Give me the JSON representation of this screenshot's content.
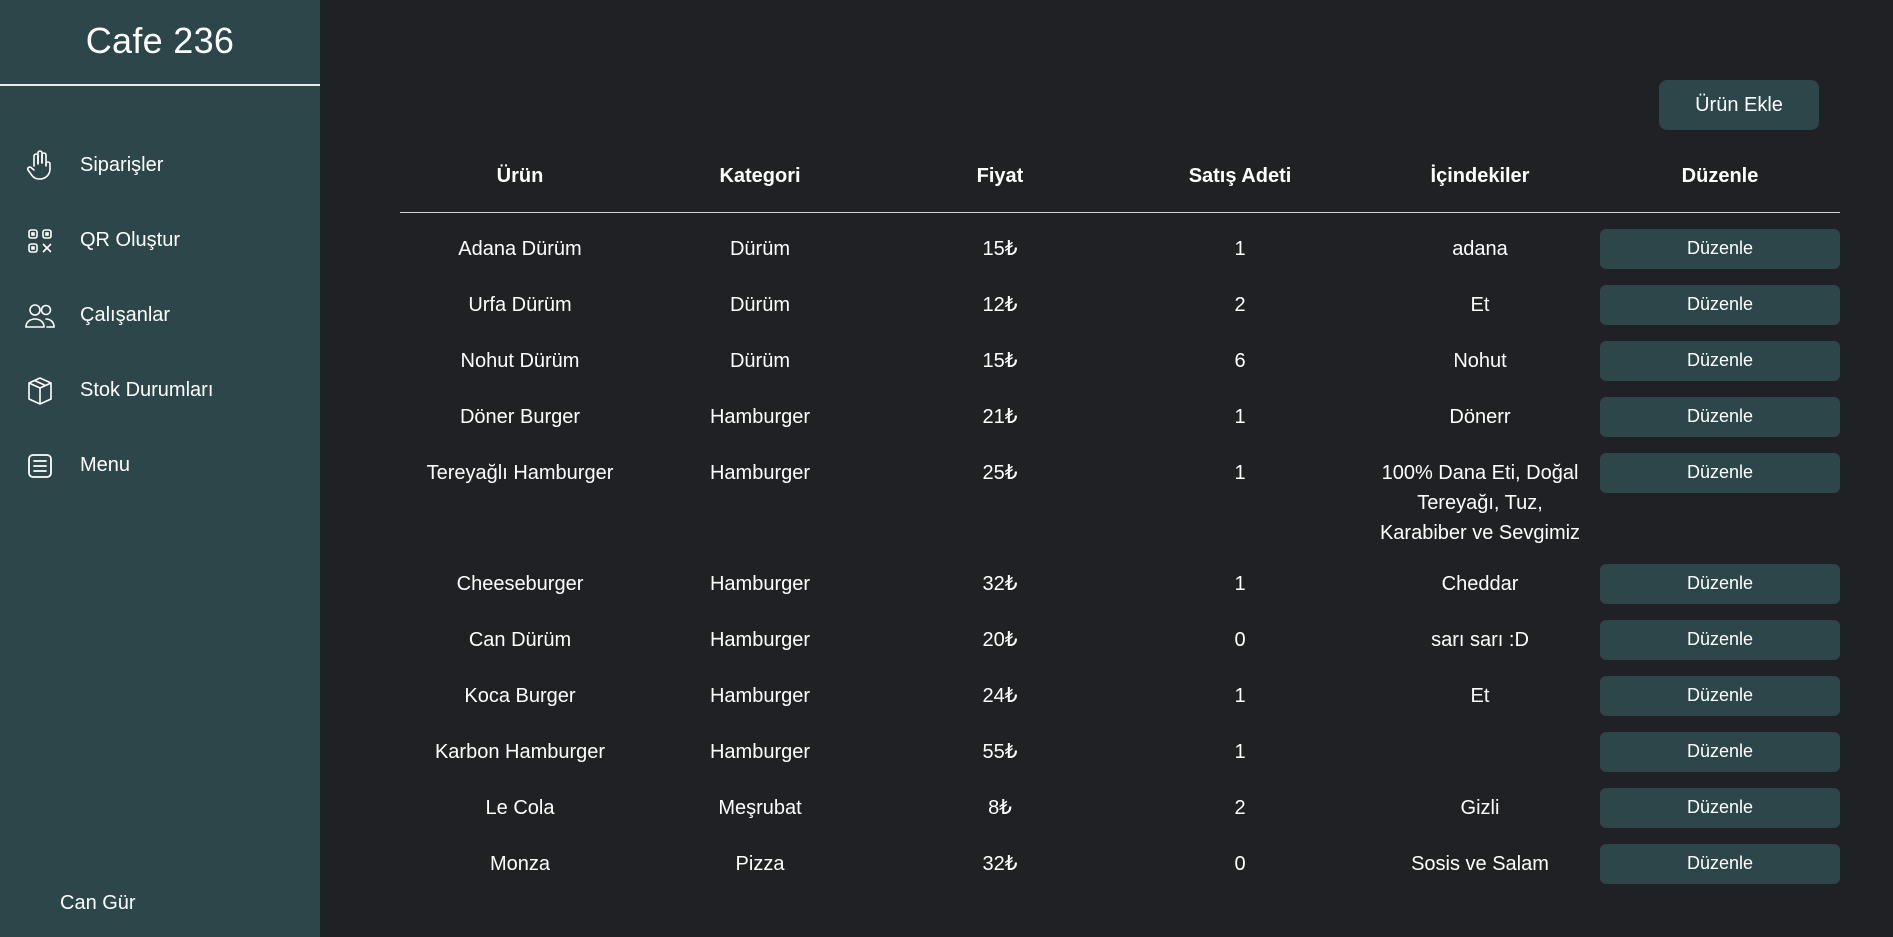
{
  "brand": "Cafe 236",
  "sidebar": {
    "items": [
      {
        "label": "Siparişler",
        "icon": "hand-icon"
      },
      {
        "label": "QR Oluştur",
        "icon": "qr-code-icon"
      },
      {
        "label": "Çalışanlar",
        "icon": "users-icon"
      },
      {
        "label": "Stok Durumları",
        "icon": "box-icon"
      },
      {
        "label": "Menu",
        "icon": "list-icon"
      }
    ],
    "user": "Can Gür"
  },
  "main": {
    "add_button": "Ürün Ekle",
    "columns": [
      "Ürün",
      "Kategori",
      "Fiyat",
      "Satış Adeti",
      "İçindekiler",
      "Düzenle"
    ],
    "edit_label": "Düzenle",
    "rows": [
      {
        "name": "Adana Dürüm",
        "category": "Dürüm",
        "price": "15₺",
        "sales": "1",
        "ingredients": "adana"
      },
      {
        "name": "Urfa Dürüm",
        "category": "Dürüm",
        "price": "12₺",
        "sales": "2",
        "ingredients": "Et"
      },
      {
        "name": "Nohut Dürüm",
        "category": "Dürüm",
        "price": "15₺",
        "sales": "6",
        "ingredients": "Nohut"
      },
      {
        "name": "Döner Burger",
        "category": "Hamburger",
        "price": "21₺",
        "sales": "1",
        "ingredients": "Dönerr"
      },
      {
        "name": "Tereyağlı Hamburger",
        "category": "Hamburger",
        "price": "25₺",
        "sales": "1",
        "ingredients": "100% Dana Eti, Doğal Tereyağı, Tuz, Karabiber ve Sevgimiz"
      },
      {
        "name": "Cheeseburger",
        "category": "Hamburger",
        "price": "32₺",
        "sales": "1",
        "ingredients": "Cheddar"
      },
      {
        "name": "Can Dürüm",
        "category": "Hamburger",
        "price": "20₺",
        "sales": "0",
        "ingredients": "sarı sarı :D"
      },
      {
        "name": "Koca Burger",
        "category": "Hamburger",
        "price": "24₺",
        "sales": "1",
        "ingredients": "Et"
      },
      {
        "name": "Karbon Hamburger",
        "category": "Hamburger",
        "price": "55₺",
        "sales": "1",
        "ingredients": ""
      },
      {
        "name": "Le Cola",
        "category": "Meşrubat",
        "price": "8₺",
        "sales": "2",
        "ingredients": "Gizli"
      },
      {
        "name": "Monza",
        "category": "Pizza",
        "price": "32₺",
        "sales": "0",
        "ingredients": "Sosis ve Salam"
      }
    ]
  },
  "colors": {
    "sidebar_bg": "#2c4649",
    "page_bg": "#1f2125",
    "button_bg": "#2c4649",
    "text": "#ffffff"
  }
}
